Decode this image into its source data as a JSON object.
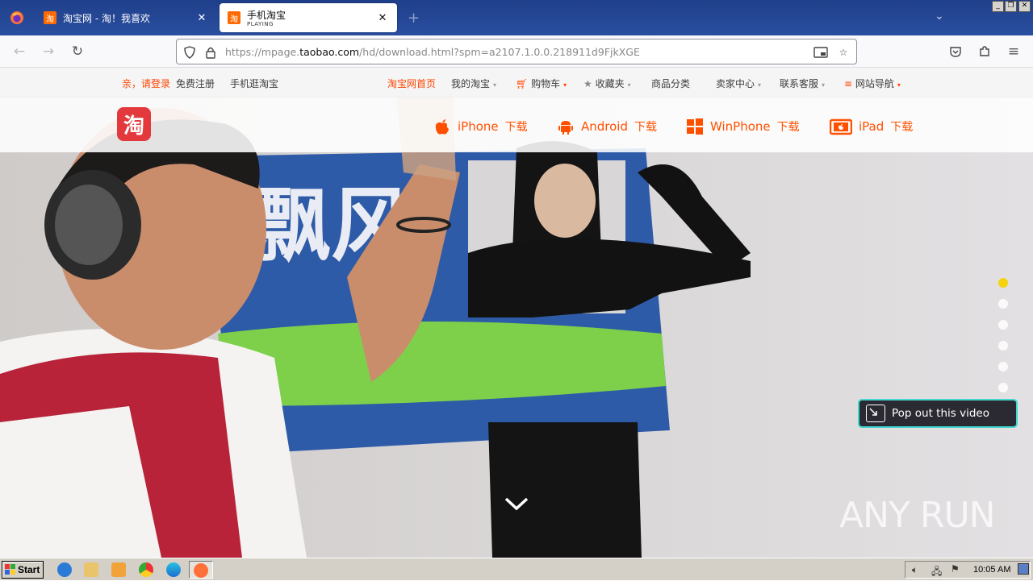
{
  "browser": {
    "tabs": [
      {
        "title": "淘宝网 - 淘！我喜欢",
        "subtitle": ""
      },
      {
        "title": "手机淘宝",
        "subtitle": "PLAYING"
      }
    ],
    "url_prefix": "https://mpage.",
    "url_domain": "taobao.com",
    "url_suffix": "/hd/download.html?spm=a2107.1.0.0.218911d9FjkXGE"
  },
  "site_nav": {
    "greeting": "亲，请登录",
    "register": "免费注册",
    "mobile": "手机逛淘宝",
    "home": "淘宝网首页",
    "my_taobao": "我的淘宝",
    "cart": "购物车",
    "favorites": "收藏夹",
    "categories": "商品分类",
    "seller": "卖家中心",
    "service": "联系客服",
    "sitemap": "网站导航"
  },
  "download_bar": {
    "logo_char": "淘",
    "items": [
      {
        "platform": "iPhone",
        "suffix": "下载",
        "icon": "apple-icon"
      },
      {
        "platform": "Android",
        "suffix": "下载",
        "icon": "android-icon"
      },
      {
        "platform": "WinPhone",
        "suffix": "下载",
        "icon": "windows-icon"
      },
      {
        "platform": "iPad",
        "suffix": "下载",
        "icon": "ipad-icon"
      }
    ]
  },
  "hero": {
    "sign_text": "飘风",
    "active_slide": 1,
    "slide_count": 6
  },
  "popout": {
    "label": "Pop out this video"
  },
  "watermark": "ANY RUN",
  "taskbar": {
    "start_label": "Start",
    "clock": "10:05 AM"
  },
  "colors": {
    "accent": "#ff5000",
    "tab_bar": "#2a4fa0",
    "active_dot": "#f5d30c",
    "popout_border": "#41d8cf"
  }
}
